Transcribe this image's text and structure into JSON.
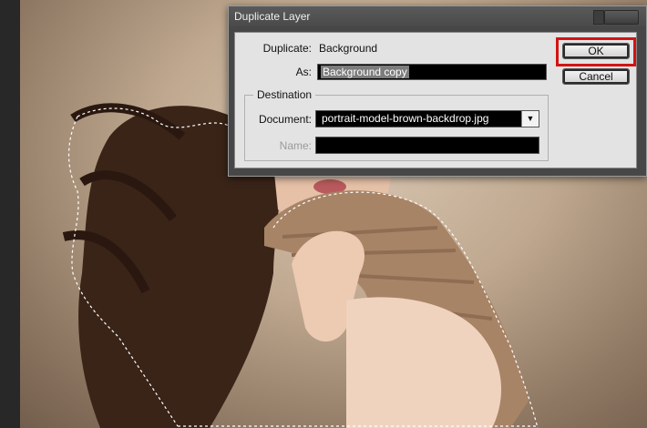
{
  "dialog": {
    "title": "Duplicate Layer",
    "duplicate_label": "Duplicate:",
    "duplicate_value": "Background",
    "as_label": "As:",
    "as_value": "Background copy",
    "destination_label": "Destination",
    "document_label": "Document:",
    "document_value": "portrait-model-brown-backdrop.jpg",
    "name_label": "Name:",
    "name_value": "",
    "ok_label": "OK",
    "cancel_label": "Cancel"
  },
  "colors": {
    "highlight": "#d21414",
    "dialog_bg": "#474747",
    "panel_bg": "#e3e3e3"
  }
}
